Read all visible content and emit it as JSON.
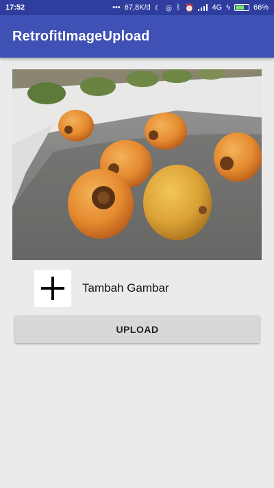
{
  "status_bar": {
    "time": "17:52",
    "dots": "•••",
    "network_speed": "67,8K/d",
    "network_type": "4G",
    "battery_percent": "66%",
    "battery_level": 0.66
  },
  "app_bar": {
    "title": "RetrofitImageUpload"
  },
  "image_preview": {
    "icon": "coconuts-photo"
  },
  "add_image": {
    "icon": "plus-icon",
    "label": "Tambah Gambar"
  },
  "upload_button": {
    "label": "UPLOAD"
  },
  "colors": {
    "status_bar": "#2f3e9e",
    "app_bar": "#3f51b5",
    "background": "#ebebeb",
    "button": "#d6d7d7"
  }
}
